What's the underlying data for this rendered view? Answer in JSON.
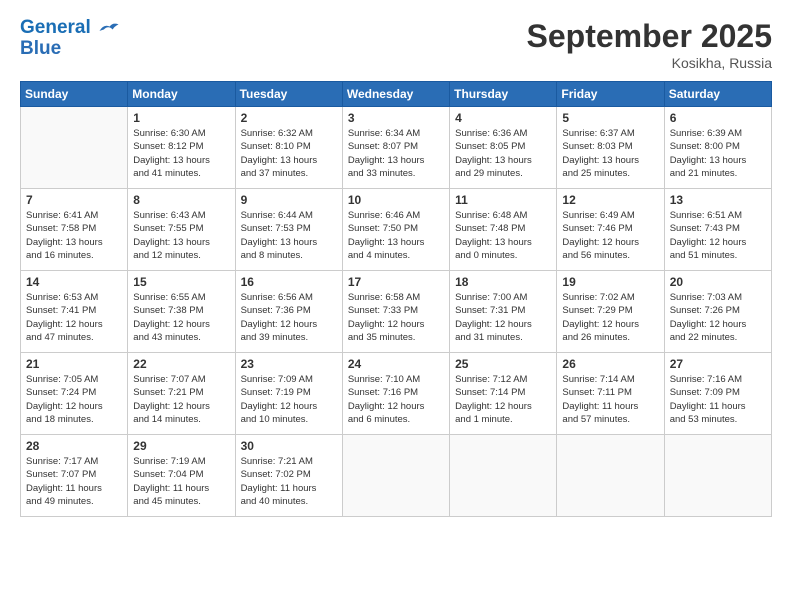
{
  "header": {
    "logo_line1": "General",
    "logo_line2": "Blue",
    "month": "September 2025",
    "location": "Kosikha, Russia"
  },
  "weekdays": [
    "Sunday",
    "Monday",
    "Tuesday",
    "Wednesday",
    "Thursday",
    "Friday",
    "Saturday"
  ],
  "weeks": [
    [
      {
        "day": "",
        "info": ""
      },
      {
        "day": "1",
        "info": "Sunrise: 6:30 AM\nSunset: 8:12 PM\nDaylight: 13 hours\nand 41 minutes."
      },
      {
        "day": "2",
        "info": "Sunrise: 6:32 AM\nSunset: 8:10 PM\nDaylight: 13 hours\nand 37 minutes."
      },
      {
        "day": "3",
        "info": "Sunrise: 6:34 AM\nSunset: 8:07 PM\nDaylight: 13 hours\nand 33 minutes."
      },
      {
        "day": "4",
        "info": "Sunrise: 6:36 AM\nSunset: 8:05 PM\nDaylight: 13 hours\nand 29 minutes."
      },
      {
        "day": "5",
        "info": "Sunrise: 6:37 AM\nSunset: 8:03 PM\nDaylight: 13 hours\nand 25 minutes."
      },
      {
        "day": "6",
        "info": "Sunrise: 6:39 AM\nSunset: 8:00 PM\nDaylight: 13 hours\nand 21 minutes."
      }
    ],
    [
      {
        "day": "7",
        "info": "Sunrise: 6:41 AM\nSunset: 7:58 PM\nDaylight: 13 hours\nand 16 minutes."
      },
      {
        "day": "8",
        "info": "Sunrise: 6:43 AM\nSunset: 7:55 PM\nDaylight: 13 hours\nand 12 minutes."
      },
      {
        "day": "9",
        "info": "Sunrise: 6:44 AM\nSunset: 7:53 PM\nDaylight: 13 hours\nand 8 minutes."
      },
      {
        "day": "10",
        "info": "Sunrise: 6:46 AM\nSunset: 7:50 PM\nDaylight: 13 hours\nand 4 minutes."
      },
      {
        "day": "11",
        "info": "Sunrise: 6:48 AM\nSunset: 7:48 PM\nDaylight: 13 hours\nand 0 minutes."
      },
      {
        "day": "12",
        "info": "Sunrise: 6:49 AM\nSunset: 7:46 PM\nDaylight: 12 hours\nand 56 minutes."
      },
      {
        "day": "13",
        "info": "Sunrise: 6:51 AM\nSunset: 7:43 PM\nDaylight: 12 hours\nand 51 minutes."
      }
    ],
    [
      {
        "day": "14",
        "info": "Sunrise: 6:53 AM\nSunset: 7:41 PM\nDaylight: 12 hours\nand 47 minutes."
      },
      {
        "day": "15",
        "info": "Sunrise: 6:55 AM\nSunset: 7:38 PM\nDaylight: 12 hours\nand 43 minutes."
      },
      {
        "day": "16",
        "info": "Sunrise: 6:56 AM\nSunset: 7:36 PM\nDaylight: 12 hours\nand 39 minutes."
      },
      {
        "day": "17",
        "info": "Sunrise: 6:58 AM\nSunset: 7:33 PM\nDaylight: 12 hours\nand 35 minutes."
      },
      {
        "day": "18",
        "info": "Sunrise: 7:00 AM\nSunset: 7:31 PM\nDaylight: 12 hours\nand 31 minutes."
      },
      {
        "day": "19",
        "info": "Sunrise: 7:02 AM\nSunset: 7:29 PM\nDaylight: 12 hours\nand 26 minutes."
      },
      {
        "day": "20",
        "info": "Sunrise: 7:03 AM\nSunset: 7:26 PM\nDaylight: 12 hours\nand 22 minutes."
      }
    ],
    [
      {
        "day": "21",
        "info": "Sunrise: 7:05 AM\nSunset: 7:24 PM\nDaylight: 12 hours\nand 18 minutes."
      },
      {
        "day": "22",
        "info": "Sunrise: 7:07 AM\nSunset: 7:21 PM\nDaylight: 12 hours\nand 14 minutes."
      },
      {
        "day": "23",
        "info": "Sunrise: 7:09 AM\nSunset: 7:19 PM\nDaylight: 12 hours\nand 10 minutes."
      },
      {
        "day": "24",
        "info": "Sunrise: 7:10 AM\nSunset: 7:16 PM\nDaylight: 12 hours\nand 6 minutes."
      },
      {
        "day": "25",
        "info": "Sunrise: 7:12 AM\nSunset: 7:14 PM\nDaylight: 12 hours\nand 1 minute."
      },
      {
        "day": "26",
        "info": "Sunrise: 7:14 AM\nSunset: 7:11 PM\nDaylight: 11 hours\nand 57 minutes."
      },
      {
        "day": "27",
        "info": "Sunrise: 7:16 AM\nSunset: 7:09 PM\nDaylight: 11 hours\nand 53 minutes."
      }
    ],
    [
      {
        "day": "28",
        "info": "Sunrise: 7:17 AM\nSunset: 7:07 PM\nDaylight: 11 hours\nand 49 minutes."
      },
      {
        "day": "29",
        "info": "Sunrise: 7:19 AM\nSunset: 7:04 PM\nDaylight: 11 hours\nand 45 minutes."
      },
      {
        "day": "30",
        "info": "Sunrise: 7:21 AM\nSunset: 7:02 PM\nDaylight: 11 hours\nand 40 minutes."
      },
      {
        "day": "",
        "info": ""
      },
      {
        "day": "",
        "info": ""
      },
      {
        "day": "",
        "info": ""
      },
      {
        "day": "",
        "info": ""
      }
    ]
  ]
}
